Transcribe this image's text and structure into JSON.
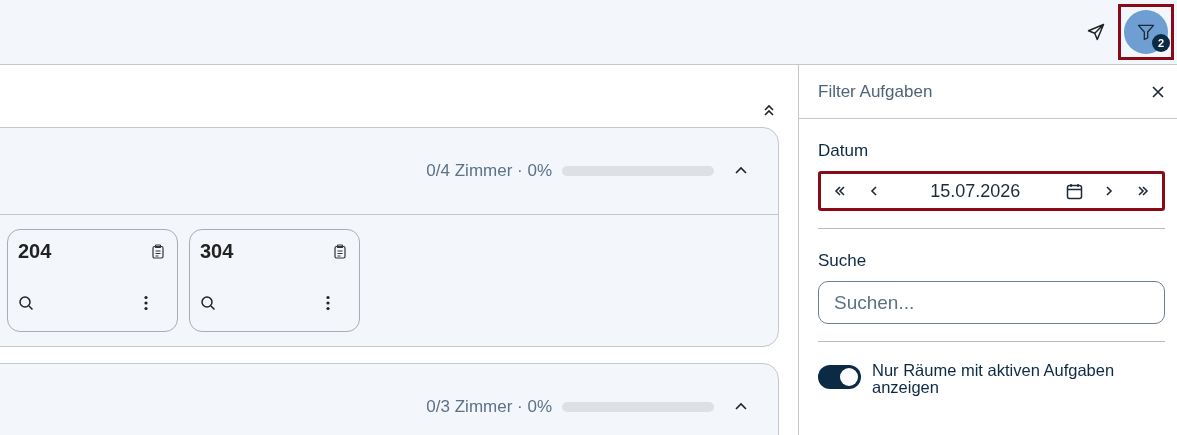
{
  "top_bar": {
    "filter_button": {
      "badge": "2",
      "highlighted": true
    }
  },
  "groups": [
    {
      "progress_text": "0/4 Zimmer · 0%",
      "level": 0,
      "expanded": true,
      "rooms": [
        {
          "number": "204"
        },
        {
          "number": "304"
        }
      ]
    },
    {
      "progress_text": "0/3 Zimmer · 0%",
      "level": 0,
      "expanded": true
    }
  ],
  "filter_panel": {
    "title": "Filter Aufgaben",
    "date": {
      "label": "Datum",
      "value": "15.07.2026",
      "highlighted": true
    },
    "search": {
      "label": "Suche",
      "placeholder": "Suchen..."
    },
    "toggle": {
      "label": "Nur Räume mit aktiven Aufgaben anzeigen",
      "on": true
    }
  }
}
